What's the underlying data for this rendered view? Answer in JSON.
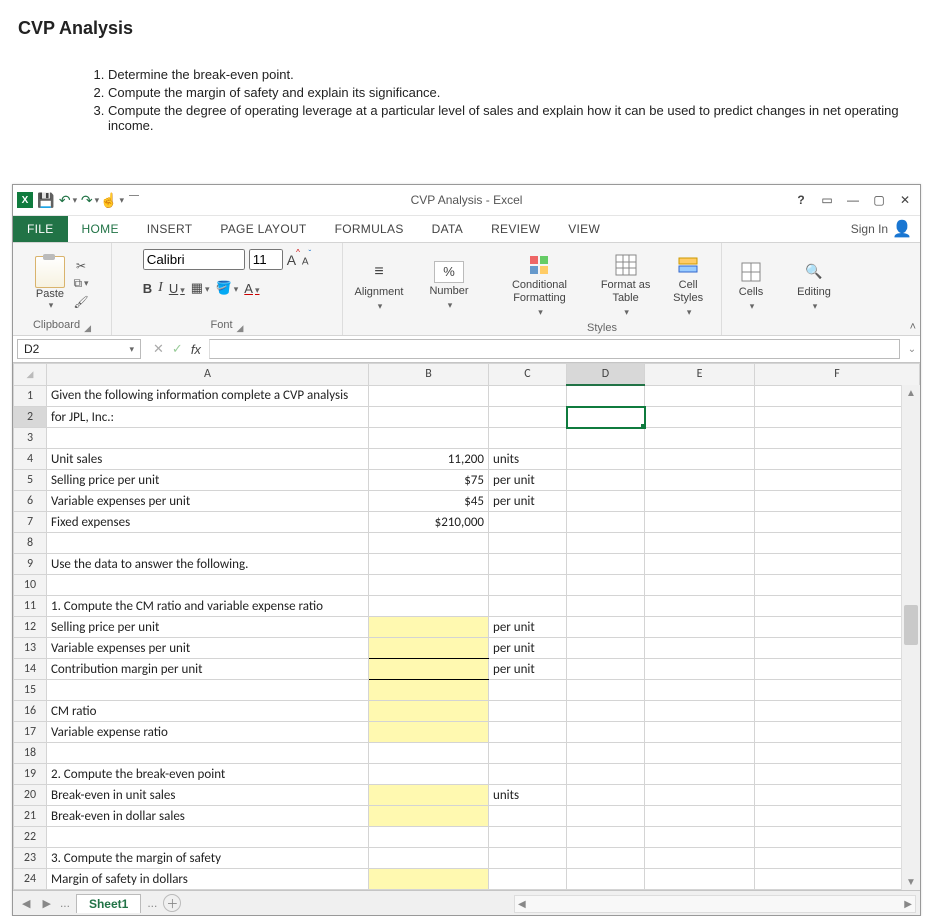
{
  "doc": {
    "heading": "CVP Analysis",
    "items": [
      "Determine the break-even point.",
      "Compute the margin of safety and explain its significance.",
      "Compute the degree of operating leverage at a particular level of sales and explain how it can be used to predict changes in net operating income."
    ]
  },
  "window": {
    "title": "CVP Analysis - Excel",
    "help": "?",
    "signin": "Sign In"
  },
  "tabs": {
    "file": "FILE",
    "home": "HOME",
    "insert": "INSERT",
    "page_layout": "PAGE LAYOUT",
    "formulas": "FORMULAS",
    "data": "DATA",
    "review": "REVIEW",
    "view": "VIEW"
  },
  "ribbon": {
    "paste": "Paste",
    "font_name": "Calibri",
    "font_size": "11",
    "group_clipboard": "Clipboard",
    "group_font": "Font",
    "group_styles": "Styles",
    "alignment": "Alignment",
    "number": "Number",
    "cond_fmt": "Conditional Formatting",
    "fmt_table": "Format as Table",
    "cell_styles": "Cell Styles",
    "cells": "Cells",
    "editing": "Editing",
    "percent": "%"
  },
  "namebox": "D2",
  "columns": [
    "A",
    "B",
    "C",
    "D",
    "E",
    "F"
  ],
  "rows": [
    {
      "n": "1",
      "a": "Given the following information complete a CVP analysis",
      "b": "",
      "c": ""
    },
    {
      "n": "2",
      "a": "for JPL, Inc.:",
      "b": "",
      "c": ""
    },
    {
      "n": "3",
      "a": "",
      "b": "",
      "c": ""
    },
    {
      "n": "4",
      "a": "Unit sales",
      "b": "11,200",
      "c": "units"
    },
    {
      "n": "5",
      "a": "Selling price per unit",
      "b": "$75",
      "c": "per unit"
    },
    {
      "n": "6",
      "a": "Variable expenses per unit",
      "b": "$45",
      "c": "per unit"
    },
    {
      "n": "7",
      "a": "Fixed expenses",
      "b": "$210,000",
      "c": ""
    },
    {
      "n": "8",
      "a": "",
      "b": "",
      "c": ""
    },
    {
      "n": "9",
      "a": "Use the data to answer the following.",
      "b": "",
      "c": ""
    },
    {
      "n": "10",
      "a": "",
      "b": "",
      "c": ""
    },
    {
      "n": "11",
      "a": "1. Compute the CM ratio and variable expense ratio",
      "b": "",
      "c": ""
    },
    {
      "n": "12",
      "a": "Selling price per unit",
      "b": "",
      "c": "per unit"
    },
    {
      "n": "13",
      "a": "Variable expenses per unit",
      "b": "",
      "c": "per unit"
    },
    {
      "n": "14",
      "a": "Contribution margin per unit",
      "b": "",
      "c": "per unit"
    },
    {
      "n": "15",
      "a": "",
      "b": "",
      "c": ""
    },
    {
      "n": "16",
      "a": "CM ratio",
      "b": "",
      "c": ""
    },
    {
      "n": "17",
      "a": "Variable expense ratio",
      "b": "",
      "c": ""
    },
    {
      "n": "18",
      "a": "",
      "b": "",
      "c": ""
    },
    {
      "n": "19",
      "a": "2. Compute the break-even point",
      "b": "",
      "c": ""
    },
    {
      "n": "20",
      "a": "Break-even in unit sales",
      "b": "",
      "c": "units"
    },
    {
      "n": "21",
      "a": "Break-even in dollar sales",
      "b": "",
      "c": ""
    },
    {
      "n": "22",
      "a": "",
      "b": "",
      "c": ""
    },
    {
      "n": "23",
      "a": "3. Compute the margin of safety",
      "b": "",
      "c": ""
    },
    {
      "n": "24",
      "a": "Margin of safety in dollars",
      "b": "",
      "c": ""
    }
  ],
  "sheet": {
    "name": "Sheet1"
  }
}
